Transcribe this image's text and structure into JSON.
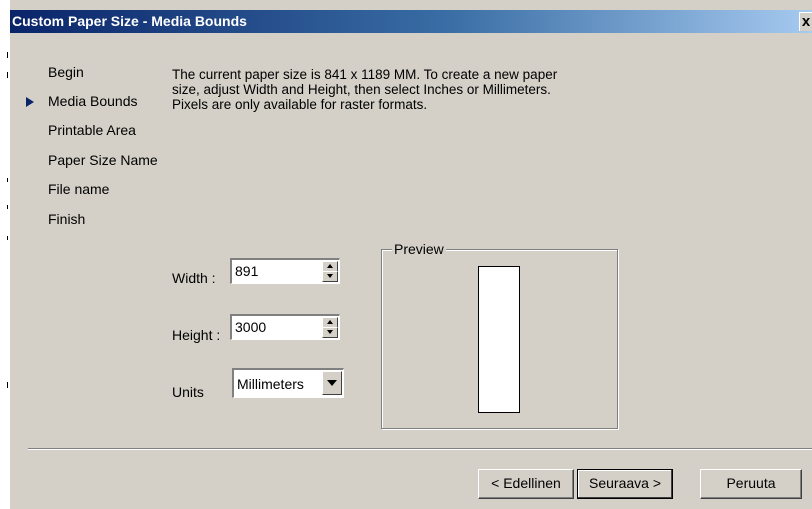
{
  "window": {
    "title": "Custom Paper Size - Media Bounds",
    "close_label": "x"
  },
  "steps": {
    "items": [
      {
        "label": "Begin",
        "current": false
      },
      {
        "label": "Media Bounds",
        "current": true
      },
      {
        "label": "Printable Area",
        "current": false
      },
      {
        "label": "Paper Size Name",
        "current": false
      },
      {
        "label": "File name",
        "current": false
      },
      {
        "label": "Finish",
        "current": false
      }
    ]
  },
  "description": {
    "line1": "The current paper size is 841 x 1189 MM. To create a new paper",
    "line2": "size, adjust Width and Height, then select Inches or Millimeters.",
    "line3": "Pixels are only available for raster formats."
  },
  "form": {
    "width_label": "Width :",
    "width_value": "891",
    "height_label": "Height :",
    "height_value": "3000",
    "units_label": "Units",
    "units_value": "Millimeters"
  },
  "preview": {
    "label": "Preview"
  },
  "buttons": {
    "back": "< Edellinen",
    "next": "Seuraava >",
    "cancel": "Peruuta"
  },
  "colors": {
    "title_gradient_start": "#0a246a",
    "title_gradient_end": "#a6caf0",
    "face": "#d4d0c8"
  }
}
